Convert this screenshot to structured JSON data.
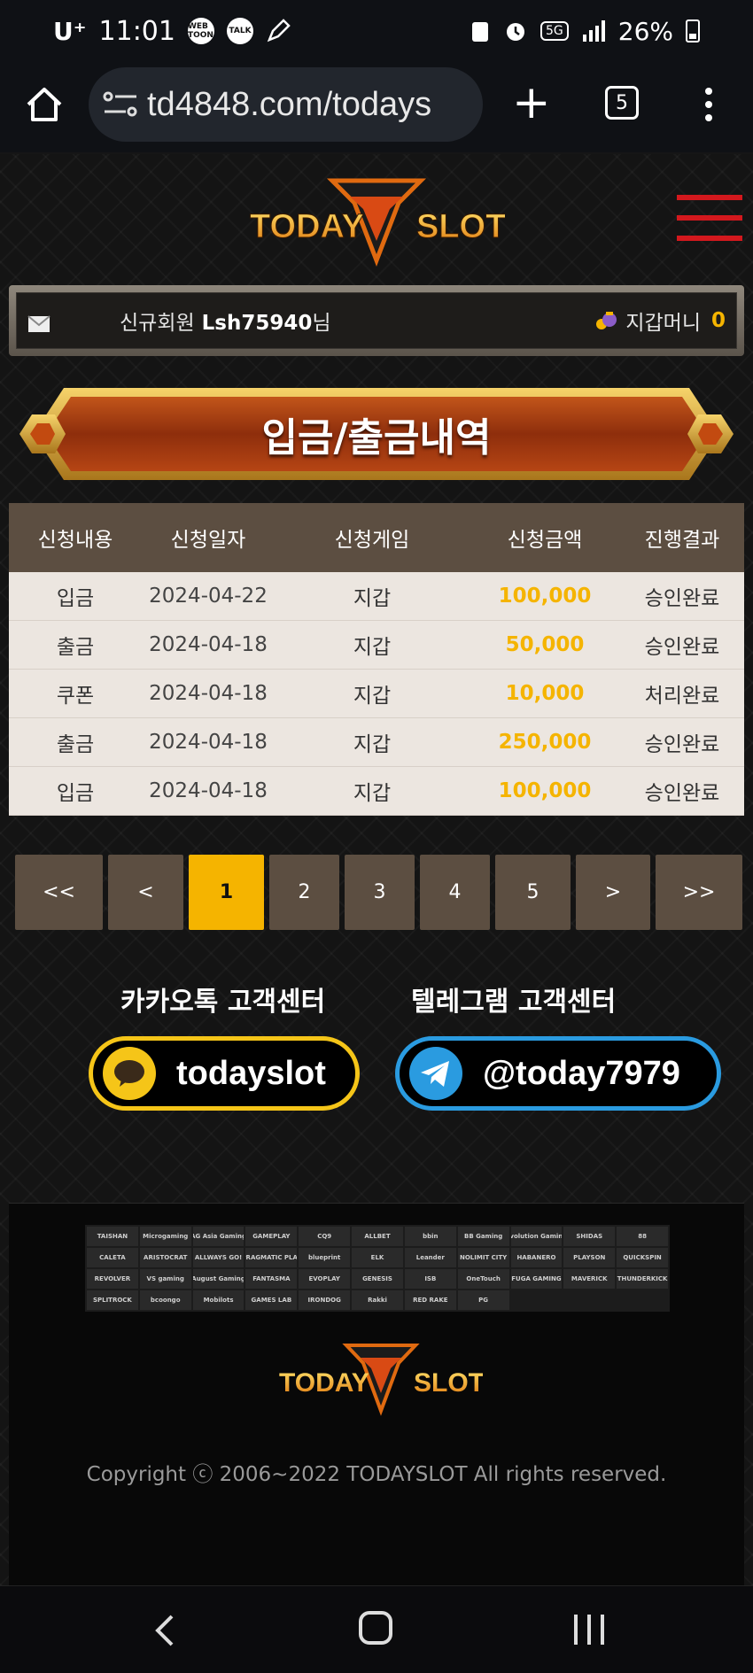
{
  "status_bar": {
    "carrier": "U⁺",
    "time": "11:01",
    "badges": [
      "WEB TOON",
      "TALK"
    ],
    "network": "5G",
    "battery": "26%"
  },
  "browser": {
    "url": "td4848.com/todays",
    "tab_count": "5"
  },
  "header": {
    "logo_left": "TODAY",
    "logo_right": "SLOT"
  },
  "member_bar": {
    "prefix": "신규회원",
    "username": "Lsh75940",
    "suffix": "님",
    "wallet_label": "지갑머니",
    "wallet_amount": "0"
  },
  "page_title": "입금/출금내역",
  "table": {
    "headers": [
      "신청내용",
      "신청일자",
      "신청게임",
      "신청금액",
      "진행결과"
    ],
    "rows": [
      [
        "입금",
        "2024-04-22",
        "지갑",
        "100,000",
        "승인완료"
      ],
      [
        "출금",
        "2024-04-18",
        "지갑",
        "50,000",
        "승인완료"
      ],
      [
        "쿠폰",
        "2024-04-18",
        "지갑",
        "10,000",
        "처리완료"
      ],
      [
        "출금",
        "2024-04-18",
        "지갑",
        "250,000",
        "승인완료"
      ],
      [
        "입금",
        "2024-04-18",
        "지갑",
        "100,000",
        "승인완료"
      ]
    ]
  },
  "pagination": {
    "first": "<<",
    "prev": "<",
    "pages": [
      "1",
      "2",
      "3",
      "4",
      "5"
    ],
    "active_page": "1",
    "next": ">",
    "last": ">>"
  },
  "customer_service": {
    "kakao_title": "카카오톡 고객센터",
    "kakao_id": "todayslot",
    "telegram_title": "텔레그램 고객센터",
    "telegram_id": "@today7979"
  },
  "footer": {
    "partners": [
      "TAISHAN",
      "Microgaming",
      "AG Asia Gaming",
      "GAMEPLAY",
      "CQ9",
      "ALLBET",
      "bbin",
      "BB Gaming",
      "Evolution Gaming",
      "SHIDAS",
      "88",
      "CALETA",
      "ARISTOCRAT",
      "ALLWAYS GO!",
      "PRAGMATIC PLAY",
      "blueprint",
      "ELK",
      "Leander",
      "NOLIMIT CITY",
      "HABANERO",
      "PLAYSON",
      "QUICKSPIN",
      "REVOLVER",
      "VS gaming",
      "August Gaming",
      "FANTASMA",
      "EVOPLAY",
      "GENESIS",
      "ISB",
      "OneTouch",
      "FUGA GAMING",
      "MAVERICK",
      "THUNDERKICK",
      "SPLITROCK",
      "bcoongo",
      "Mobilots",
      "GAMES LAB",
      "IRONDOG",
      "Rakki",
      "RED RAKE",
      "PG"
    ],
    "logo_left": "TODAY",
    "logo_right": "SLOT",
    "copyright": "Copyright ⓒ 2006~2022 TODAYSLOT All rights reserved."
  },
  "colors": {
    "accent_gold": "#f5b400",
    "brown": "#5c4e41",
    "menu_red": "#d3181d",
    "kakao_yellow": "#f5c518",
    "telegram_blue": "#2a9be0"
  }
}
